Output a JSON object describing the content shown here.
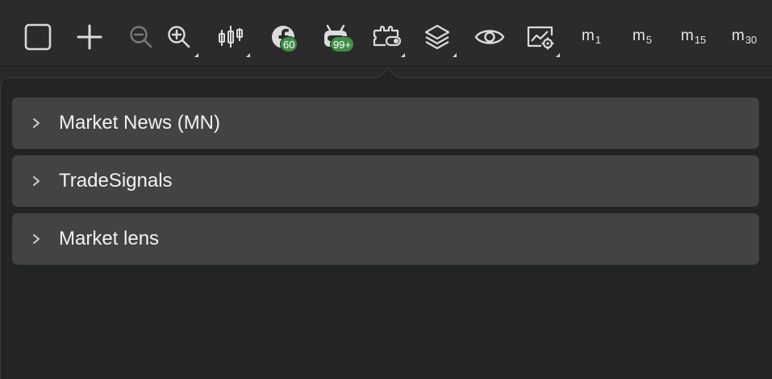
{
  "toolbar": {
    "buttons": [
      {
        "id": "crosshair",
        "icon": "square-icon"
      },
      {
        "id": "add",
        "icon": "plus-icon"
      },
      {
        "id": "zoom-out",
        "icon": "zoom-out-icon"
      },
      {
        "id": "zoom-in",
        "icon": "zoom-in-icon"
      },
      {
        "id": "chart-type",
        "icon": "candlestick-icon"
      },
      {
        "id": "social",
        "icon": "social-feed-icon",
        "badge": "60"
      },
      {
        "id": "signals",
        "icon": "robot-icon",
        "badge": "99+"
      },
      {
        "id": "plugins",
        "icon": "plugin-icon"
      },
      {
        "id": "layers",
        "icon": "layers-icon"
      },
      {
        "id": "watch",
        "icon": "eye-icon"
      },
      {
        "id": "chart-settings",
        "icon": "chart-settings-icon"
      }
    ],
    "social_badge": "60",
    "signals_badge": "99+",
    "timeframes": [
      {
        "base": "m",
        "sub": "1"
      },
      {
        "base": "m",
        "sub": "5"
      },
      {
        "base": "m",
        "sub": "15"
      },
      {
        "base": "m",
        "sub": "30"
      }
    ]
  },
  "popover": {
    "sections": [
      {
        "label": "Market News (MN)",
        "expanded": false
      },
      {
        "label": "TradeSignals",
        "expanded": false
      },
      {
        "label": "Market lens",
        "expanded": false
      }
    ]
  },
  "colors": {
    "toolbar_bg": "#2b2b2c",
    "popover_bg": "#232424",
    "section_bg": "#434344",
    "badge_green": "#3f8f46",
    "icon": "#d8d8d8",
    "icon_disabled": "#7a7a7a"
  }
}
